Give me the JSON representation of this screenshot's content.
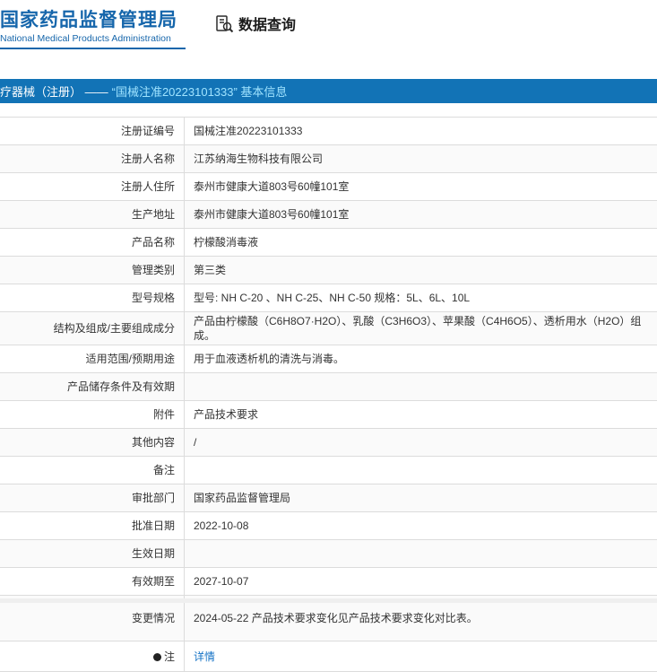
{
  "header": {
    "title": "国家药品监督管理局",
    "subtitle": "National Medical Products Administration",
    "nav_label": "数据查询",
    "nav_icon": "document-magnifier-icon"
  },
  "banner": {
    "prefix": "疗器械（注册） ——",
    "highlight": "“国械注准20223101333” 基本信息"
  },
  "colors": {
    "logo_blue": "#1666ab",
    "banner_blue": "#1273b6",
    "banner_highlight": "#9fe3ff",
    "link_blue": "#1673c6",
    "border_gray": "#dcdcdc"
  },
  "table": {
    "rows": [
      {
        "label": "注册证编号",
        "value": "国械注准20223101333"
      },
      {
        "label": "注册人名称",
        "value": "江苏纳海生物科技有限公司"
      },
      {
        "label": "注册人住所",
        "value": "泰州市健康大道803号60幢101室"
      },
      {
        "label": "生产地址",
        "value": "泰州市健康大道803号60幢101室"
      },
      {
        "label": "产品名称",
        "value": "柠檬酸消毒液"
      },
      {
        "label": "管理类别",
        "value": "第三类"
      },
      {
        "label": "型号规格",
        "value": "型号: NH C-20 、NH C-25、NH C-50 规格：5L、6L、10L"
      },
      {
        "label": "结构及组成/主要组成成分",
        "value": "产品由柠檬酸（C6H8O7·H2O）、乳酸（C3H6O3）、苹果酸（C4H6O5）、透析用水（H2O）组成。"
      },
      {
        "label": "适用范围/预期用途",
        "value": "用于血液透析机的清洗与消毒。"
      },
      {
        "label": "产品储存条件及有效期",
        "value": ""
      },
      {
        "label": "附件",
        "value": "产品技术要求"
      },
      {
        "label": "其他内容",
        "value": "/"
      },
      {
        "label": "备注",
        "value": ""
      },
      {
        "label": "审批部门",
        "value": "国家药品监督管理局"
      },
      {
        "label": "批准日期",
        "value": "2022-10-08"
      },
      {
        "label": "生效日期",
        "value": ""
      },
      {
        "label": "有效期至",
        "value": "2027-10-07"
      },
      {
        "label": "变更情况",
        "value": "2024-05-22 产品技术要求变化见产品技术要求变化对比表。"
      },
      {
        "label": "注",
        "value": "详情",
        "link": true,
        "label_icon": "note-dot-icon"
      }
    ]
  }
}
